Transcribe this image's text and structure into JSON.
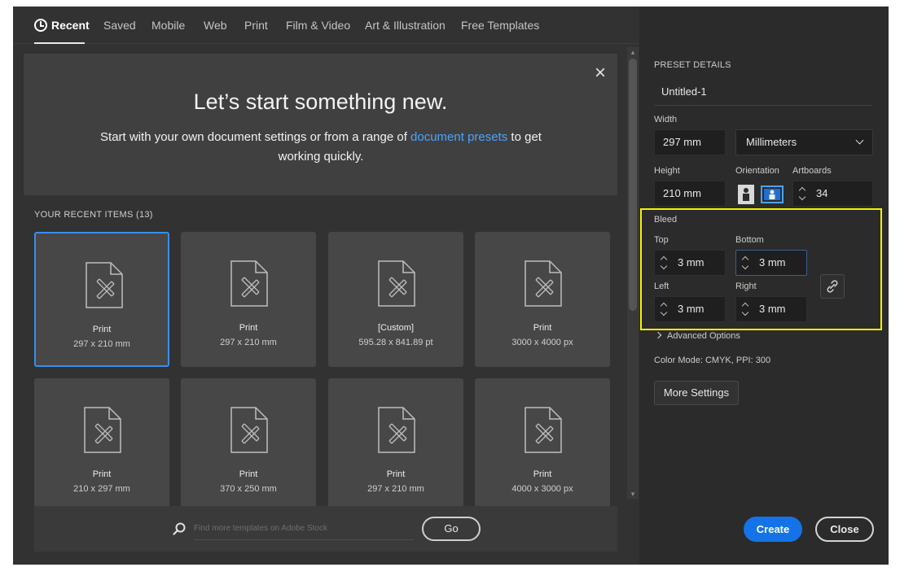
{
  "nav": {
    "tabs": [
      {
        "label": "Recent"
      },
      {
        "label": "Saved"
      },
      {
        "label": "Mobile"
      },
      {
        "label": "Web"
      },
      {
        "label": "Print"
      },
      {
        "label": "Film & Video"
      },
      {
        "label": "Art & Illustration"
      },
      {
        "label": "Free Templates"
      }
    ]
  },
  "hero": {
    "title": "Let’s start something new.",
    "sub_before": "Start with your own document settings or from a range of ",
    "sub_link": "document presets",
    "sub_after": " to get working quickly.",
    "close": "×"
  },
  "recent": {
    "heading": "YOUR RECENT ITEMS",
    "count": "(13)",
    "items": [
      {
        "title": "Print",
        "size": "297 x 210 mm"
      },
      {
        "title": "Print",
        "size": "297 x 210 mm"
      },
      {
        "title": "[Custom]",
        "size": "595.28 x 841.89 pt"
      },
      {
        "title": "Print",
        "size": "3000 x 4000 px"
      },
      {
        "title": "Print",
        "size": "210 x 297 mm"
      },
      {
        "title": "Print",
        "size": "370 x 250 mm"
      },
      {
        "title": "Print",
        "size": "297 x 210 mm"
      },
      {
        "title": "Print",
        "size": "4000 x 3000 px"
      }
    ]
  },
  "search": {
    "placeholder": "Find more templates on Adobe Stock",
    "go": "Go"
  },
  "preset": {
    "heading": "PRESET DETAILS",
    "name": "Untitled-1",
    "width_label": "Width",
    "width": "297 mm",
    "units": "Millimeters",
    "height_label": "Height",
    "height": "210 mm",
    "orientation_label": "Orientation",
    "artboards_label": "Artboards",
    "artboards": "34",
    "bleed_label": "Bleed",
    "top_label": "Top",
    "top": "3 mm",
    "bottom_label": "Bottom",
    "bottom": "3 mm",
    "left_label": "Left",
    "left": "3 mm",
    "right_label": "Right",
    "right": "3 mm",
    "advanced": "Advanced Options",
    "color_mode": "Color Mode: CMYK, PPI: 300",
    "more_settings": "More Settings",
    "create": "Create",
    "close": "Close"
  },
  "colors": {
    "accent": "#1473e6",
    "link": "#4ba3ff",
    "highlight": "#f2f200",
    "selected_border": "#378ef0"
  }
}
